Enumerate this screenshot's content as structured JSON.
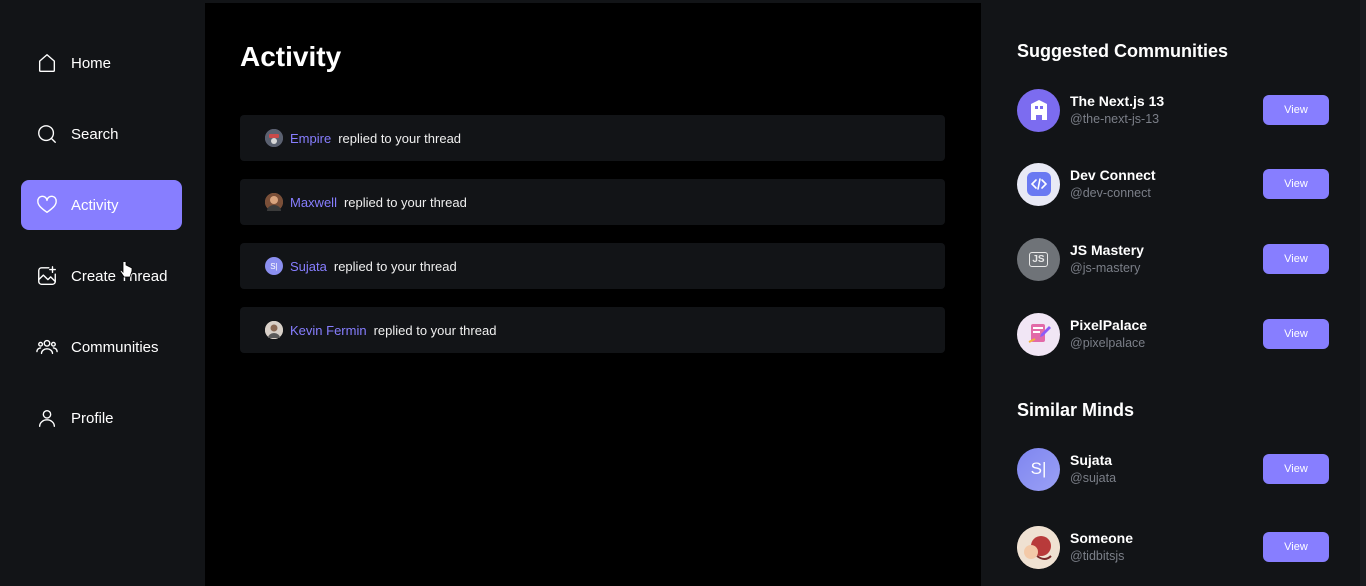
{
  "sidebar": {
    "items": [
      {
        "label": "Home",
        "icon": "home-icon",
        "active": false
      },
      {
        "label": "Search",
        "icon": "search-icon",
        "active": false
      },
      {
        "label": "Activity",
        "icon": "heart-icon",
        "active": true
      },
      {
        "label": "Create Thread",
        "icon": "image-plus-icon",
        "active": false
      },
      {
        "label": "Communities",
        "icon": "users-icon",
        "active": false
      },
      {
        "label": "Profile",
        "icon": "user-icon",
        "active": false
      }
    ]
  },
  "main": {
    "title": "Activity",
    "activities": [
      {
        "author": "Empire",
        "text": "replied to your thread"
      },
      {
        "author": "Maxwell",
        "text": "replied to your thread"
      },
      {
        "author": "Sujata",
        "text": "replied to your thread",
        "avatar_initials": "S|"
      },
      {
        "author": "Kevin Fermin",
        "text": "replied to your thread"
      }
    ]
  },
  "right": {
    "communities_title": "Suggested Communities",
    "communities": [
      {
        "name": "The Next.js 13",
        "handle": "@the-next-js-13",
        "button": "View"
      },
      {
        "name": "Dev Connect",
        "handle": "@dev-connect",
        "button": "View"
      },
      {
        "name": "JS Mastery",
        "handle": "@js-mastery",
        "button": "View",
        "avatar_text": "JS"
      },
      {
        "name": "PixelPalace",
        "handle": "@pixelpalace",
        "button": "View"
      }
    ],
    "minds_title": "Similar Minds",
    "minds": [
      {
        "name": "Sujata",
        "handle": "@sujata",
        "button": "View",
        "avatar_initials": "S|"
      },
      {
        "name": "Someone",
        "handle": "@tidbitsjs",
        "button": "View"
      }
    ]
  },
  "colors": {
    "accent": "#877eff",
    "sidebar_bg": "#121417",
    "main_bg": "#000000",
    "muted_text": "#7b7f88"
  }
}
